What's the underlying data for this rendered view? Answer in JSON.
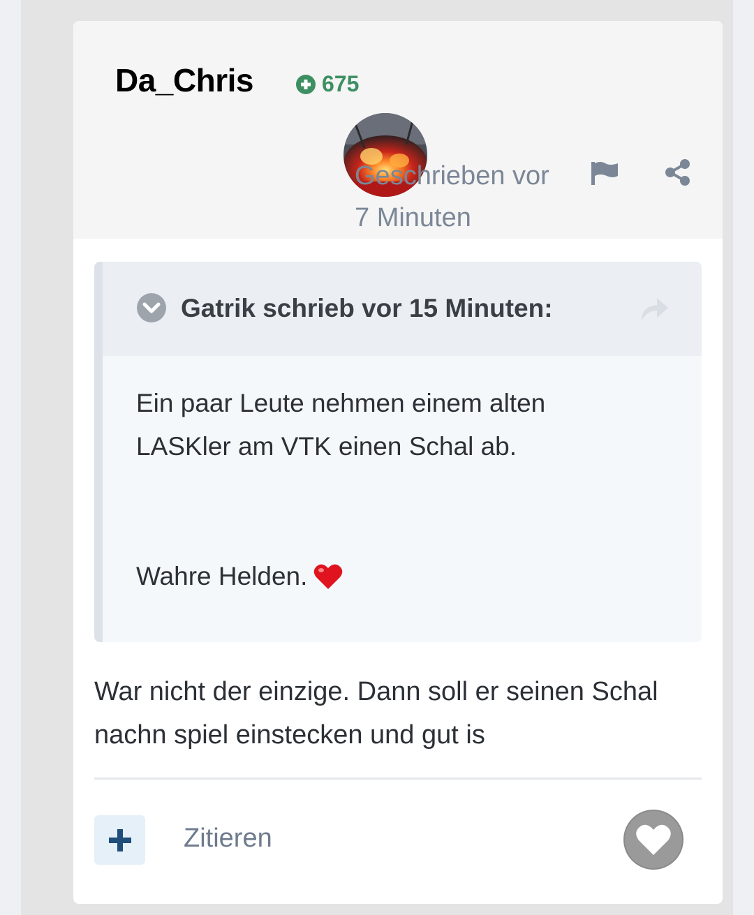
{
  "post": {
    "author": "Da_Chris",
    "reputation": "675",
    "posted_label": "Geschrieben vor",
    "posted_time": "7 Minuten",
    "body": "War nicht der einzige. Dann soll er seinen Schal nachn spiel einstecken und gut is"
  },
  "quote": {
    "citation": "Gatrik schrieb vor 15 Minuten:",
    "line1": "Ein paar Leute nehmen einem alten LASKler am VTK einen Schal ab.",
    "line2": "Wahre Helden."
  },
  "actions": {
    "quote_label": "Zitieren"
  },
  "icons": {
    "reputation": "plus-circle-icon",
    "report": "flag-icon",
    "share": "share-icon",
    "collapse": "chevron-down-circle-icon",
    "goto": "reply-arrow-icon",
    "add": "plus-icon",
    "like": "heart-icon"
  },
  "colors": {
    "reputation": "#3d8f62",
    "muted": "#7b8797",
    "add_button_bg": "#e6f0f8",
    "add_icon": "#1f4e7a",
    "like_bg": "#9a9a9a",
    "heart_emoji": "#e0141e"
  }
}
